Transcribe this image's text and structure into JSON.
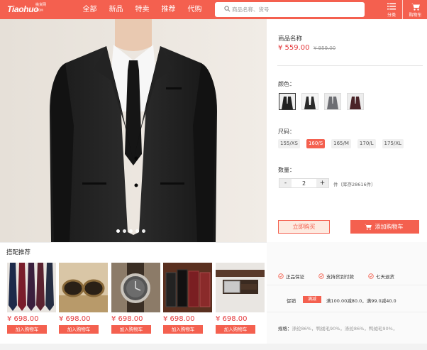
{
  "header": {
    "logo_text": "Tiaohuo",
    "logo_sub": "挑货网",
    "logo_domain": ".COM",
    "nav": [
      "全部",
      "新品",
      "特卖",
      "推荐",
      "代购"
    ],
    "search_placeholder": "商品名称、货号",
    "category_label": "分类",
    "cart_label": "购物车",
    "accent_color": "#f4604f"
  },
  "product": {
    "name": "商品名称",
    "price": "¥ 559.00",
    "original_price": "¥ 959.00",
    "color_label": "颜色：",
    "size_label": "尺码：",
    "sizes": [
      "155/XS",
      "160/S",
      "165/M",
      "170/L",
      "175/XL"
    ],
    "selected_size": "160/S",
    "qty_label": "数量：",
    "qty_minus": "-",
    "qty_plus": "+",
    "quantity": "2",
    "stock_text": "件（库存28616件）",
    "buy_now": "立即购买",
    "add_to_cart": "添加购物车"
  },
  "recommend": {
    "title": "搭配推荐",
    "items": [
      {
        "price": "¥ 698.00",
        "button": "加入购物车",
        "icon": "ties-thumbnail"
      },
      {
        "price": "¥ 698.00",
        "button": "加入购物车",
        "icon": "sunglasses-thumbnail"
      },
      {
        "price": "¥ 698.00",
        "button": "加入购物车",
        "icon": "watch-thumbnail"
      },
      {
        "price": "¥ 698.00",
        "button": "加入购物车",
        "icon": "wallets-thumbnail"
      },
      {
        "price": "¥ 698.00",
        "button": "加入购物车",
        "icon": "belt-thumbnail"
      }
    ]
  },
  "info": {
    "guarantees": [
      "正品保证",
      "支持货到付款",
      "七天退货"
    ],
    "promo_label": "促销",
    "promo_badge": "满减",
    "promo_text": "满100.00减80.0，满99.0减40.0",
    "spec_label": "规格：",
    "spec_value": "涤纶86%，鸭绒毛90%，涤纶86%，鸭绒毛90%，"
  }
}
